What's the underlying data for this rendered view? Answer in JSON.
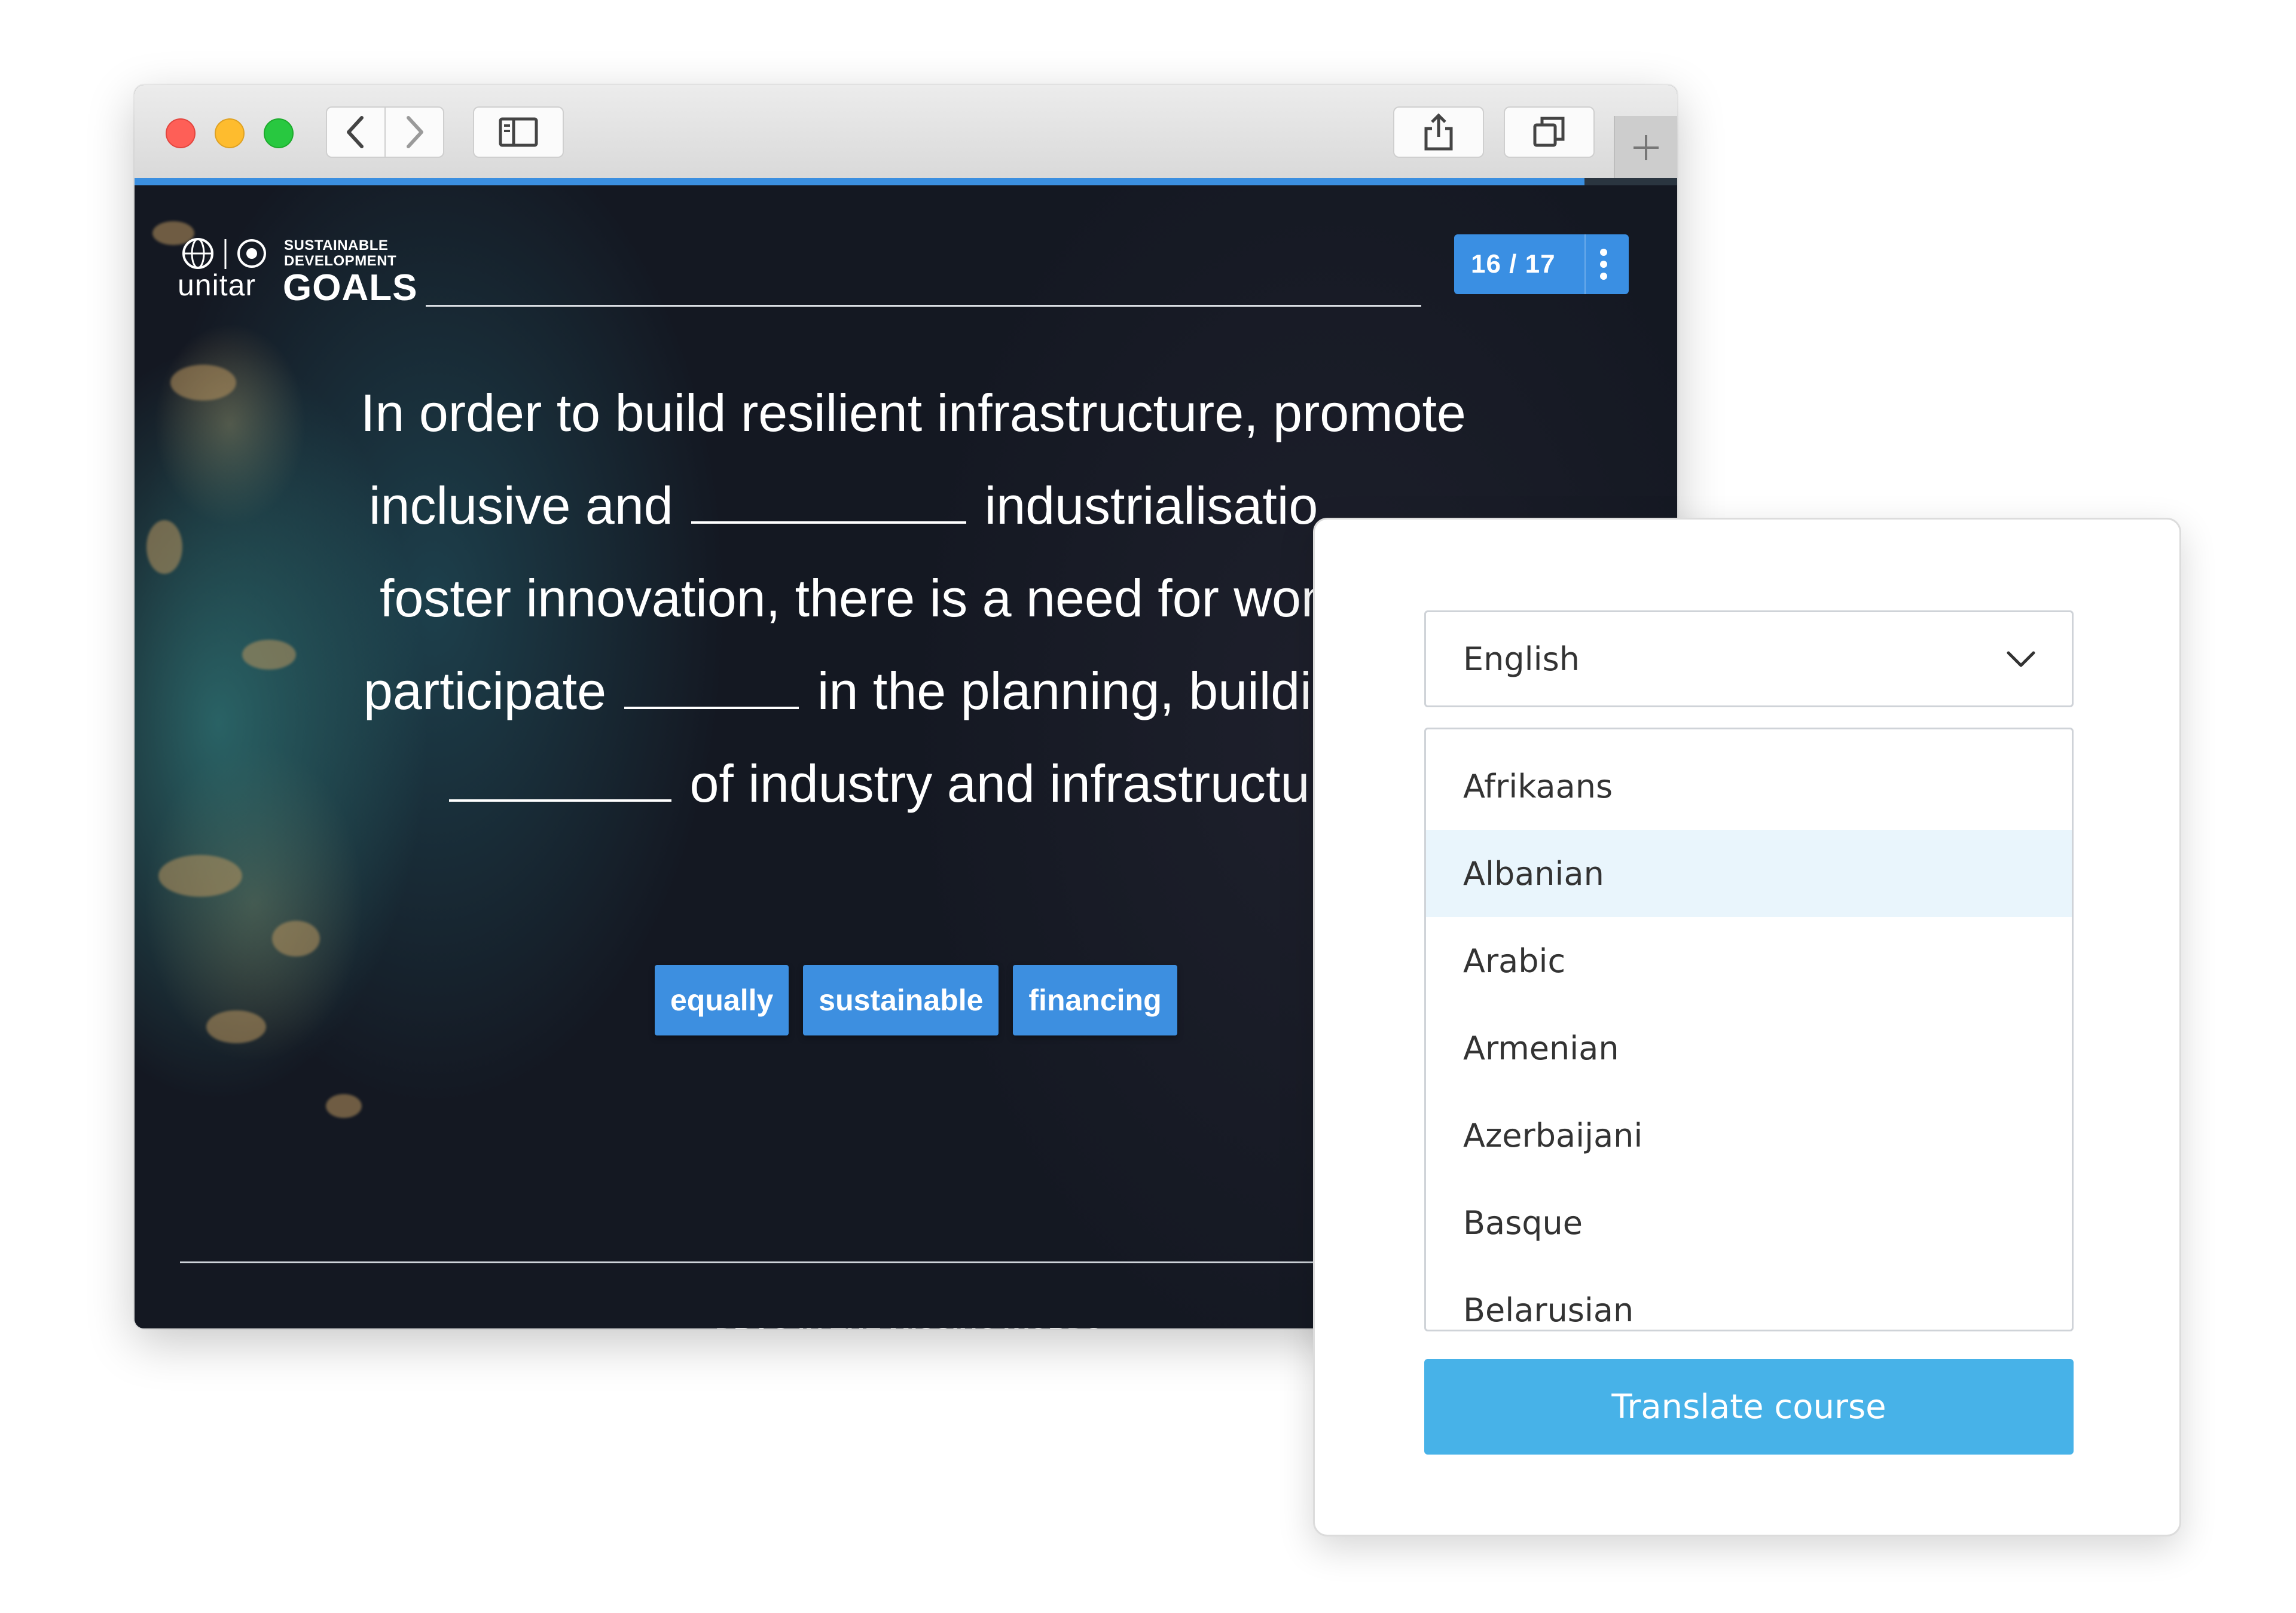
{
  "course": {
    "logo": {
      "unitar": "unitar",
      "sdg_line1": "SUSTAINABLE",
      "sdg_line2": "DEVELOPMENT",
      "sdg_goals": "GOALS"
    },
    "progress_fraction": 0.94,
    "counter": "16 / 17",
    "question_lines": [
      {
        "before": "In order to build resilient infrastructure, promote",
        "after": ""
      },
      {
        "before": "inclusive and",
        "after": "industrialisatio"
      },
      {
        "before": "foster innovation, there is a need for wom",
        "after": ""
      },
      {
        "before": "participate",
        "after": "in the planning, buildin"
      },
      {
        "before": "",
        "after": "of industry and infrastructur"
      }
    ],
    "word_chips": [
      "equally",
      "sustainable",
      "financing"
    ],
    "instruction": "DRAG IN THE MISSING WORDS"
  },
  "translate_panel": {
    "selected_language": "English",
    "languages": [
      "Afrikaans",
      "Albanian",
      "Arabic",
      "Armenian",
      "Azerbaijani",
      "Basque",
      "Belarusian"
    ],
    "highlighted_language": "Albanian",
    "button_label": "Translate course"
  },
  "colors": {
    "accent_blue": "#3a8fe3",
    "translate_button": "#47b2e8",
    "option_highlight": "#e9f5fc"
  },
  "icons": {
    "toolbar": [
      "back-icon",
      "forward-icon",
      "sidebar-icon",
      "share-icon",
      "tabs-icon",
      "plus-icon"
    ],
    "counter_menu": "more-vertical-icon",
    "select": "chevron-down-icon"
  }
}
